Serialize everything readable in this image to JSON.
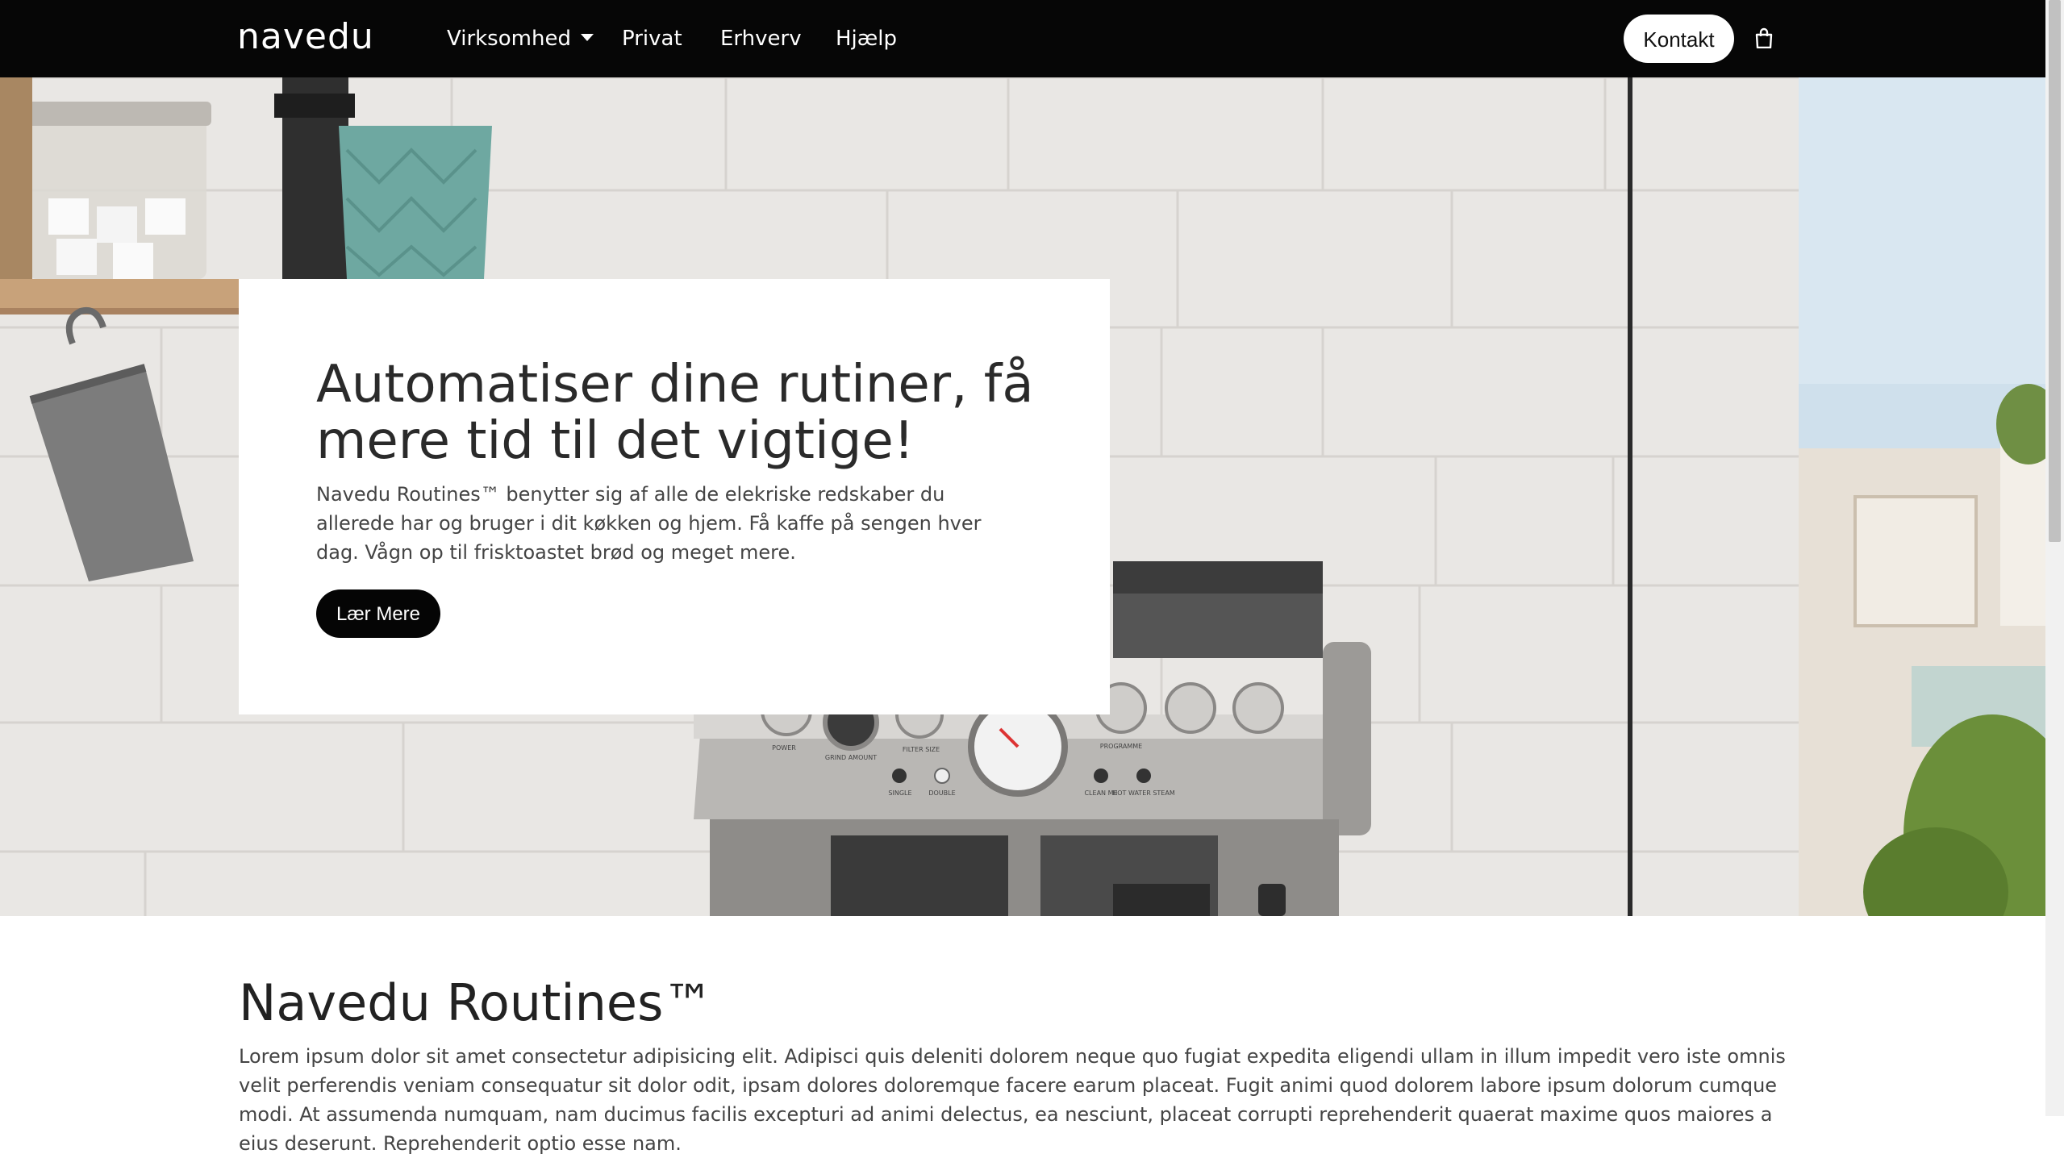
{
  "brand": {
    "logo_text": "navedu"
  },
  "nav": {
    "items": [
      {
        "label": "Virksomhed",
        "has_dropdown": true
      },
      {
        "label": "Privat"
      },
      {
        "label": "Erhverv"
      },
      {
        "label": "Hjælp"
      }
    ],
    "contact_label": "Kontakt",
    "cart_icon": "shopping-bag-icon"
  },
  "hero": {
    "title": "Automatiser dine rutiner, få mere tid til det vigtige!",
    "text": "Navedu Routines™ benytter sig af alle de elekriske redskaber du allerede har og bruger i dit køkken og hjem. Få kaffe på sengen hver dag. Vågn op til frisktoastet brød og meget mere.",
    "button_label": "Lær Mere",
    "machine_labels": [
      "POWER",
      "GRIND AMOUNT",
      "FILTER SIZE",
      "PROGRAMME",
      "SINGLE",
      "DOUBLE",
      "CLEAN ME",
      "HOT WATER STEAM"
    ]
  },
  "section": {
    "title": "Navedu Routines™",
    "text": "Lorem ipsum dolor sit amet consectetur adipisicing elit. Adipisci quis deleniti dolorem neque quo fugiat expedita eligendi ullam in illum impedit vero iste omnis velit perferendis veniam consequatur sit dolor odit, ipsam dolores doloremque facere earum placeat. Fugit animi quod dolorem labore ipsum dolorum cumque modi. At assumenda numquam, nam ducimus facilis excepturi ad animi delectus, ea nesciunt, placeat corrupti reprehenderit quaerat maxime quos maiores a eius deserunt. Reprehenderit optio esse nam."
  },
  "colors": {
    "navbar": "#060606",
    "button_dark": "#050505",
    "card": "#ffffff",
    "text": "#444444"
  }
}
